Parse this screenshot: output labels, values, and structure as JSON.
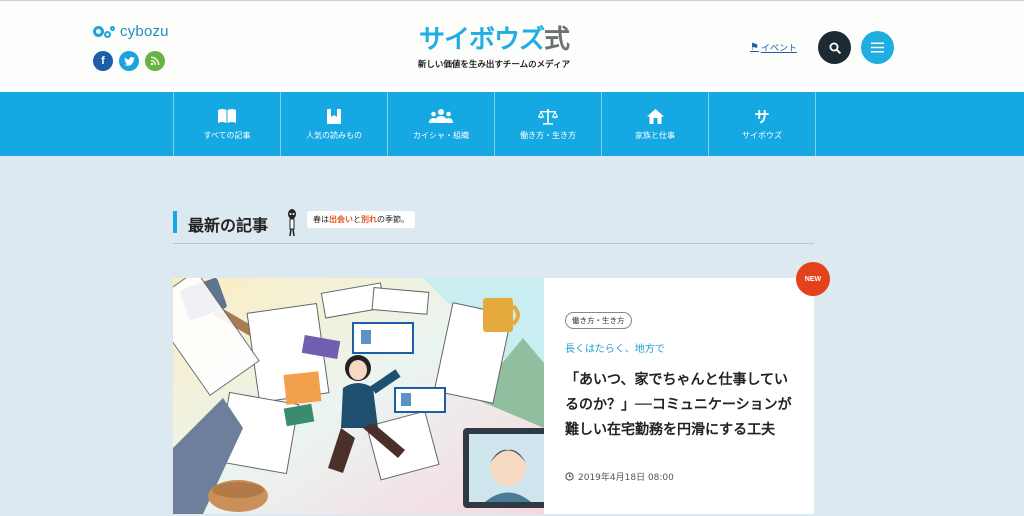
{
  "header": {
    "logo_text": "cybozu",
    "brand_title_main": "サイボウズ",
    "brand_title_suffix": "式",
    "tagline": "新しい価値を生み出すチームのメディア",
    "event_link": "イベント",
    "social": [
      {
        "icon": "facebook-icon",
        "glyph": "f"
      },
      {
        "icon": "twitter-icon",
        "glyph": "t"
      },
      {
        "icon": "rss-icon",
        "glyph": "〜"
      }
    ]
  },
  "nav": {
    "items": [
      {
        "label": "すべての記事",
        "icon": "book-icon"
      },
      {
        "label": "人気の読みもの",
        "icon": "bookmark-icon"
      },
      {
        "label": "カイシャ・組織",
        "icon": "people-icon"
      },
      {
        "label": "働き方・生き方",
        "icon": "scale-icon"
      },
      {
        "label": "家族と仕事",
        "icon": "home-icon"
      },
      {
        "label": "サイボウズ",
        "icon": "cybozu-glyph-icon",
        "glyph": "サ"
      }
    ]
  },
  "section": {
    "title": "最新の記事",
    "season_prefix": "春は",
    "season_word1": "出会い",
    "season_mid": "と",
    "season_word2": "別れ",
    "season_suffix": "の季節。"
  },
  "article": {
    "new_label": "NEW",
    "category": "働き方・生き方",
    "subtitle": "長くはたらく、地方で",
    "headline": "「あいつ、家でちゃんと仕事しているのか？」──コミュニケーションが難しい在宅勤務を円滑にする工夫",
    "date": "2019年4月18日 08:00"
  },
  "colors": {
    "brand_blue": "#15a8e2",
    "nav_bg": "#15a8e2",
    "page_bg": "#dce9f1",
    "new_badge": "#e5421c",
    "search_btn": "#1b2a33"
  }
}
